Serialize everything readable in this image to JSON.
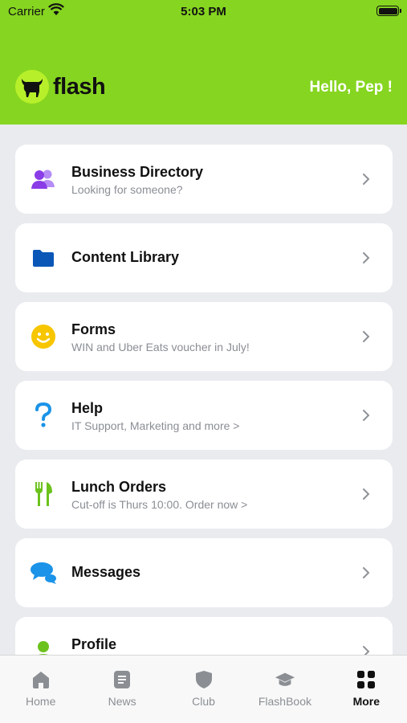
{
  "status_bar": {
    "carrier": "Carrier",
    "time": "5:03 PM"
  },
  "header": {
    "logo_text": "flash",
    "greeting": "Hello, Pep !"
  },
  "menu": [
    {
      "title": "Business Directory",
      "subtitle": "Looking for someone?",
      "icon": "people-icon",
      "icon_color": "#8a3ce6"
    },
    {
      "title": "Content Library",
      "subtitle": "",
      "icon": "folder-icon",
      "icon_color": "#0a57b8"
    },
    {
      "title": "Forms",
      "subtitle": "WIN and Uber Eats voucher in July!",
      "icon": "smiley-icon",
      "icon_color": "#f7c600"
    },
    {
      "title": "Help",
      "subtitle": "IT Support, Marketing and more >",
      "icon": "question-icon",
      "icon_color": "#1a93e8"
    },
    {
      "title": "Lunch Orders",
      "subtitle": "Cut-off is Thurs 10:00. Order now >",
      "icon": "cutlery-icon",
      "icon_color": "#6cc21c"
    },
    {
      "title": "Messages",
      "subtitle": "",
      "icon": "chat-bubbles-icon",
      "icon_color": "#1a93e8"
    },
    {
      "title": "Profile",
      "subtitle": "",
      "icon": "user-icon",
      "icon_color": "#6cc21c"
    }
  ],
  "tabs": [
    {
      "label": "Home",
      "icon": "home-icon"
    },
    {
      "label": "News",
      "icon": "news-icon"
    },
    {
      "label": "Club",
      "icon": "shield-icon"
    },
    {
      "label": "FlashBook",
      "icon": "graduation-cap-icon"
    },
    {
      "label": "More",
      "icon": "grid-icon",
      "active": true
    }
  ],
  "colors": {
    "brand": "#86d520",
    "background": "#e9ebef"
  }
}
